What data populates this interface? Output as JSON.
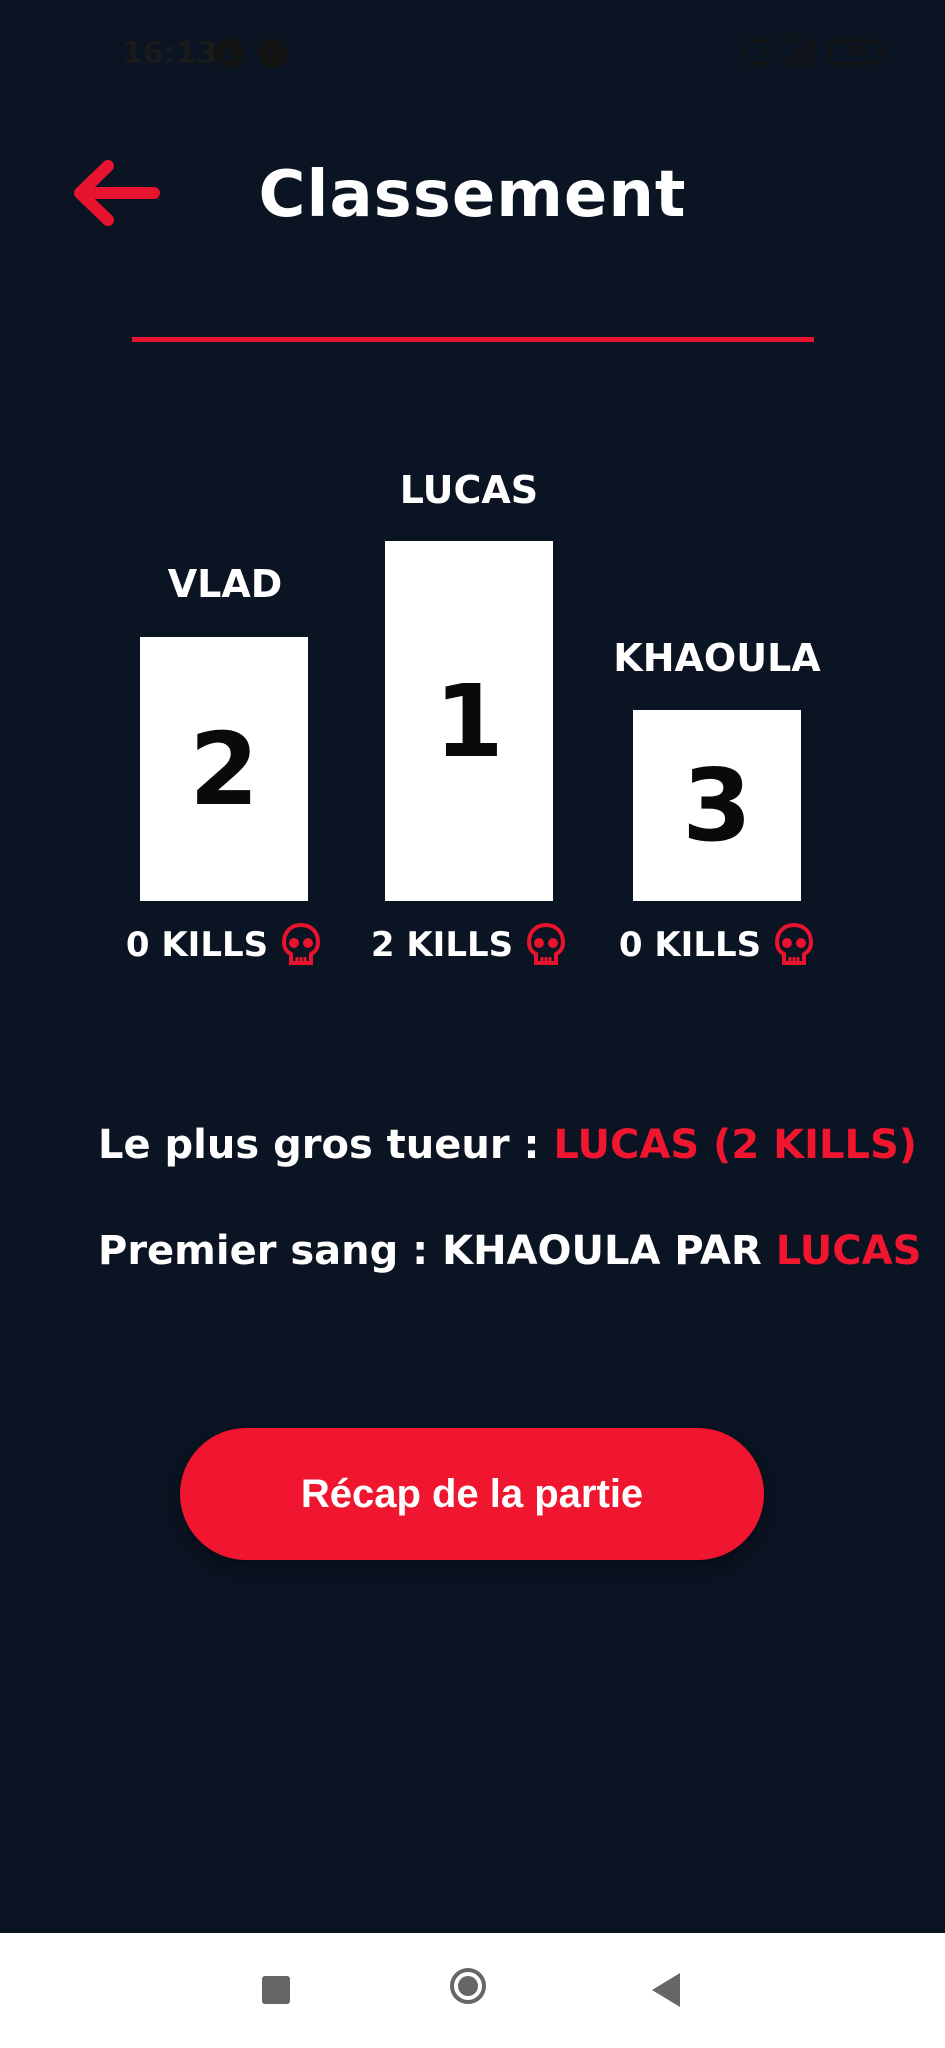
{
  "status_bar": {
    "time": "16:13",
    "network": "4G",
    "battery": "76"
  },
  "header": {
    "title": "Classement"
  },
  "podium": [
    {
      "name": "VLAD",
      "rank": "2",
      "kills": "0 KILLS"
    },
    {
      "name": "LUCAS",
      "rank": "1",
      "kills": "2 KILLS"
    },
    {
      "name": "KHAOULA",
      "rank": "3",
      "kills": "0 KILLS"
    }
  ],
  "stats": {
    "top_killer_label": "Le plus gros tueur :",
    "top_killer_value": "LUCAS (2 KILLS)",
    "first_blood_label": "Premier sang  : KHAOULA  PAR",
    "first_blood_killer": "LUCAS"
  },
  "recap_button": {
    "label": "Récap de la partie"
  },
  "colors": {
    "background": "#0a1422",
    "accent": "#f0162f",
    "podium": "#ffffff"
  },
  "icons": {
    "back": "arrow-left-icon",
    "kills": "skull-icon"
  }
}
